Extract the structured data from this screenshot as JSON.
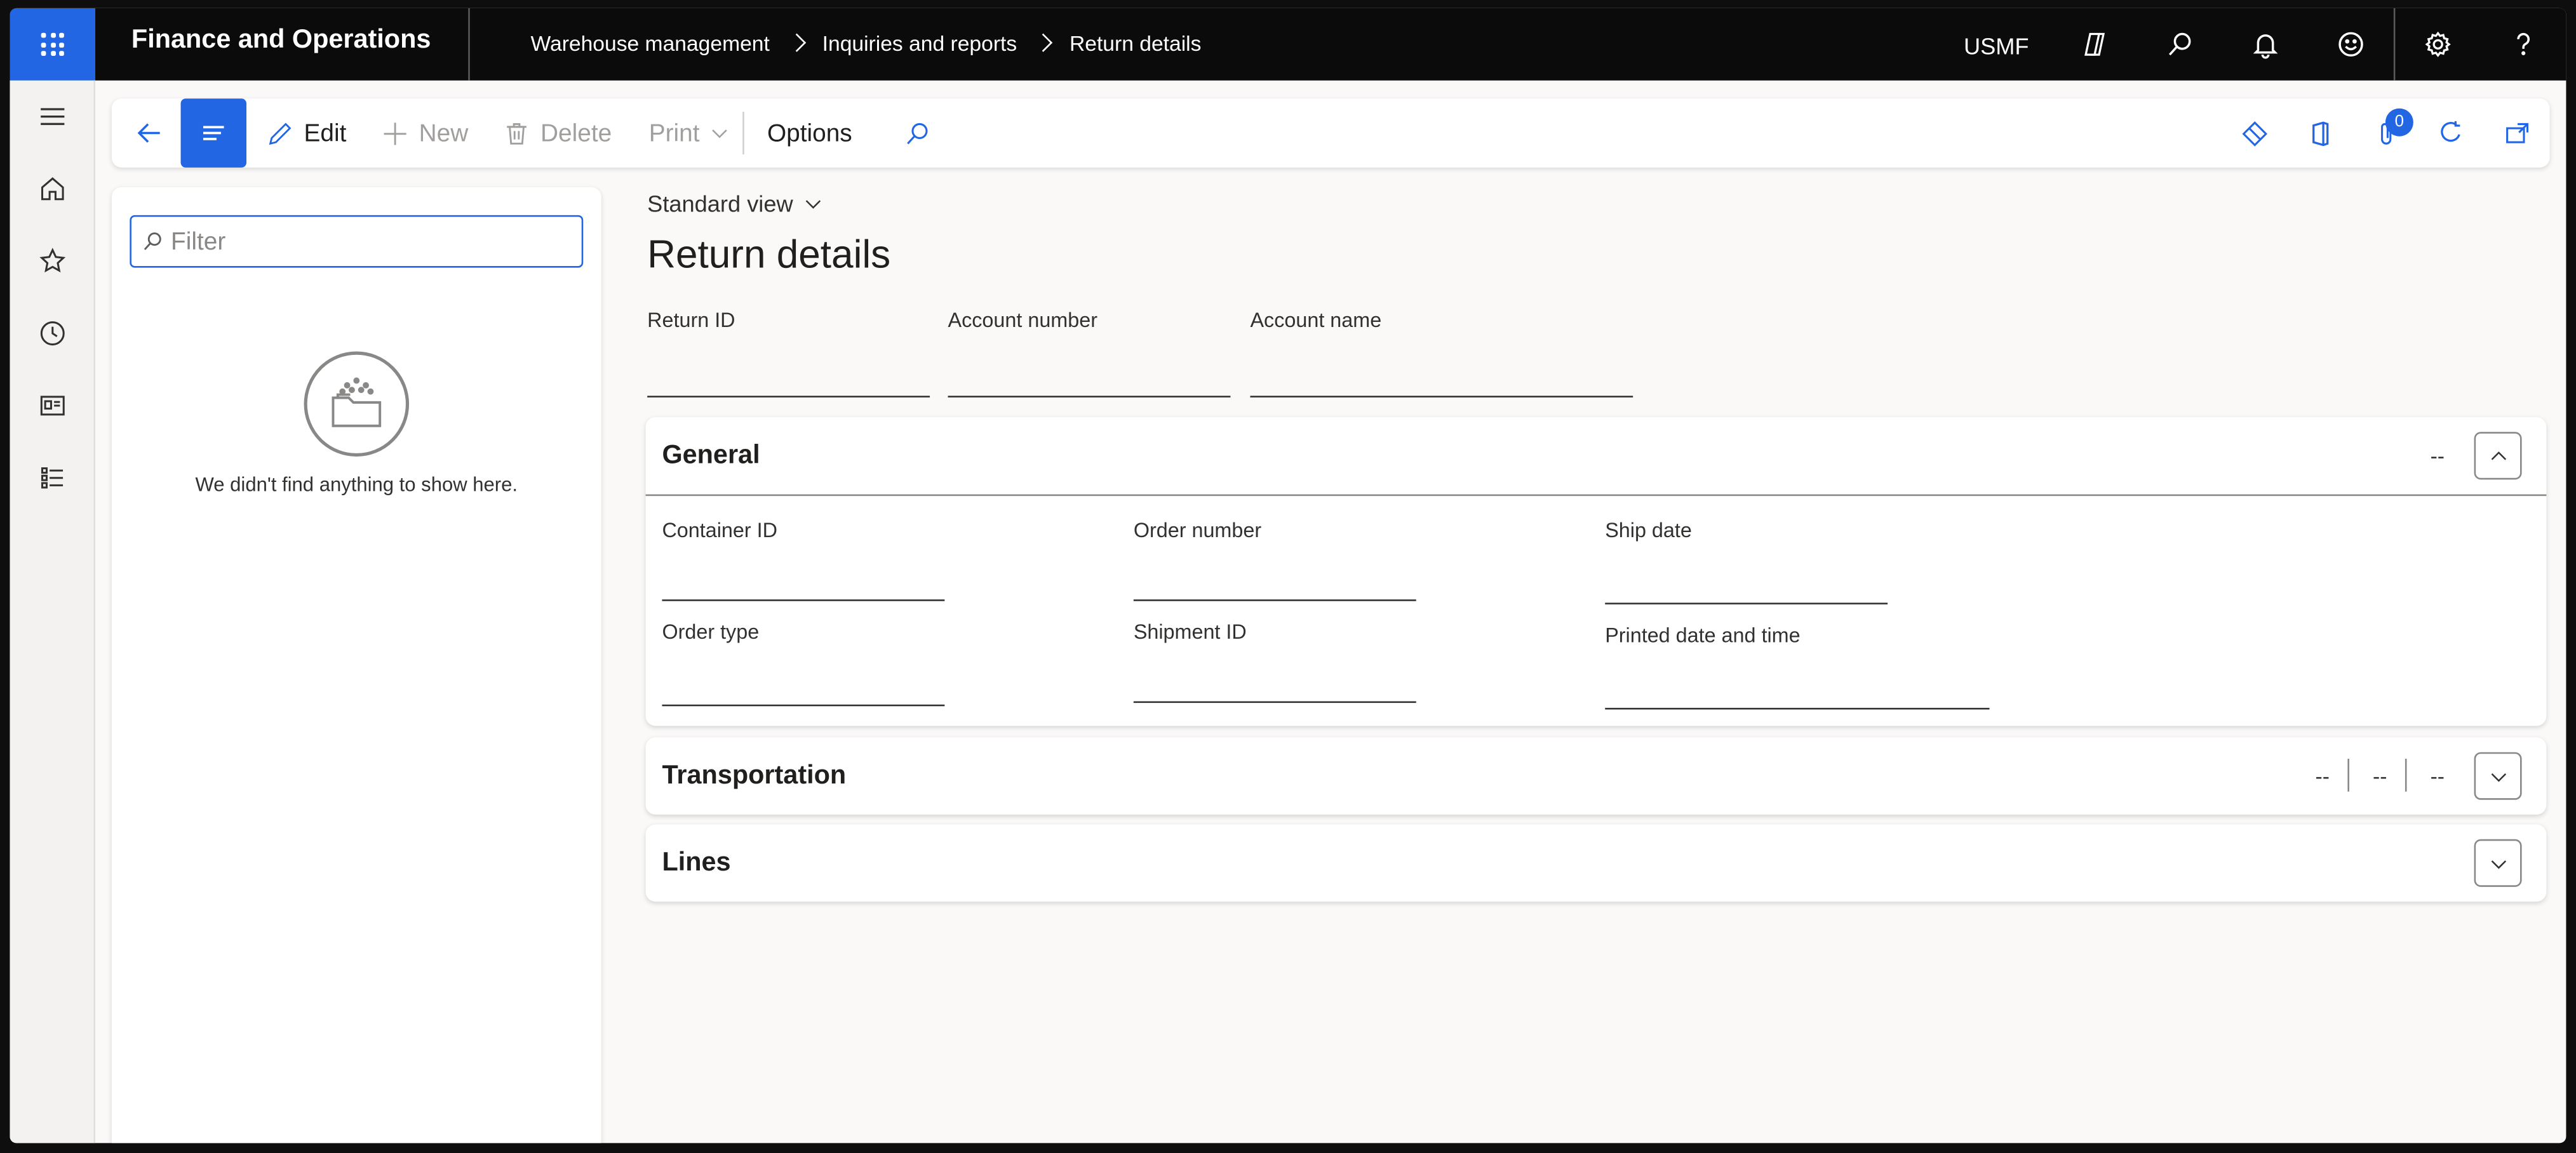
{
  "topbar": {
    "app_title": "Finance and Operations",
    "breadcrumb": [
      "Warehouse management",
      "Inquiries and reports",
      "Return details"
    ],
    "company": "USMF"
  },
  "actionpane": {
    "edit": "Edit",
    "new": "New",
    "delete": "Delete",
    "print": "Print",
    "options": "Options",
    "attachments_count": "0"
  },
  "filter": {
    "placeholder": "Filter",
    "empty_message": "We didn't find anything to show here."
  },
  "main": {
    "view": "Standard view",
    "title": "Return details",
    "header_fields": [
      {
        "label": "Return ID"
      },
      {
        "label": "Account number"
      },
      {
        "label": "Account name"
      }
    ]
  },
  "general": {
    "title": "General",
    "summary": "--",
    "fields": {
      "container_id": "Container ID",
      "order_number": "Order number",
      "ship_date": "Ship date",
      "order_type": "Order type",
      "shipment_id": "Shipment ID",
      "printed_date": "Printed date and time"
    }
  },
  "transportation": {
    "title": "Transportation",
    "summary": [
      "--",
      "--",
      "--"
    ]
  },
  "lines": {
    "title": "Lines"
  },
  "colors": {
    "accent": "#2266e3",
    "topbar": "#0b0b0b",
    "background": "#faf9f8"
  }
}
